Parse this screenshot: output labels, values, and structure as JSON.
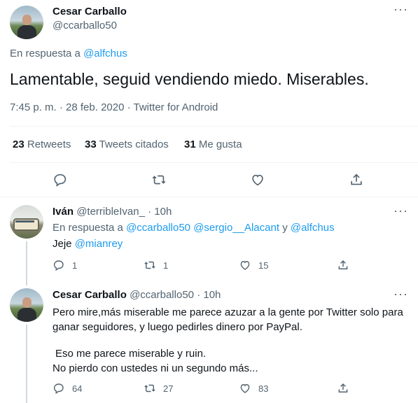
{
  "main_tweet": {
    "author_name": "Cesar Carballo",
    "author_handle": "@ccarballo50",
    "reply_prefix": "En respuesta a",
    "reply_to": "@alfchus",
    "text": "Lamentable, seguid vendiendo miedo. Miserables.",
    "meta": "7:45 p. m. · 28 feb. 2020 · Twitter for Android",
    "stats": {
      "retweets_count": "23",
      "retweets_label": "Retweets",
      "quotes_count": "33",
      "quotes_label": "Tweets citados",
      "likes_count": "31",
      "likes_label": "Me gusta"
    }
  },
  "reply1": {
    "author_name": "Iván",
    "author_handle": "@terribleIvan_",
    "time": "· 10h",
    "reply_prefix": "En respuesta a",
    "reply_to_1": "@ccarballo50",
    "reply_to_2": "@sergio__Alacant",
    "reply_sep": "y",
    "reply_to_3": "@alfchus",
    "text_prefix": "Jeje",
    "text_mention": "@mianrey",
    "replies": "1",
    "retweets": "1",
    "likes": "15"
  },
  "reply2": {
    "author_name": "Cesar Carballo",
    "author_handle": "@ccarballo50",
    "time": "· 10h",
    "line1": "Pero mire,más miserable me parece azuzar a la gente por Twitter solo para",
    "line2": "ganar seguidores, y luego pedirles dinero por PayPal.",
    "line3": "Eso me parece miserable y ruin.",
    "line4": "No pierdo con ustedes ni un segundo más...",
    "replies": "64",
    "retweets": "27",
    "likes": "83"
  },
  "icons": [
    "more-icon",
    "reply-icon",
    "retweet-icon",
    "like-icon",
    "share-icon"
  ]
}
